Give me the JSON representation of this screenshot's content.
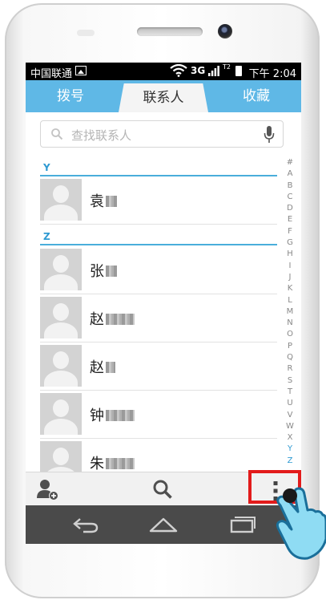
{
  "status_bar": {
    "carrier": "中国联通",
    "network": "3G",
    "sim2": "T2",
    "time": "下午 2:04"
  },
  "tabs": [
    {
      "label": "拨号",
      "active": false
    },
    {
      "label": "联系人",
      "active": true
    },
    {
      "label": "收藏",
      "active": false
    }
  ],
  "search": {
    "placeholder": "查找联系人"
  },
  "sections": [
    {
      "letter": "Y",
      "contacts": [
        {
          "name": "袁"
        }
      ]
    },
    {
      "letter": "Z",
      "contacts": [
        {
          "name": "张"
        },
        {
          "name": "赵"
        },
        {
          "name": "赵"
        },
        {
          "name": "钟"
        },
        {
          "name": "朱"
        }
      ]
    }
  ],
  "alphabet_index": [
    "#",
    "A",
    "B",
    "C",
    "D",
    "E",
    "F",
    "G",
    "H",
    "I",
    "J",
    "K",
    "L",
    "M",
    "N",
    "O",
    "P",
    "Q",
    "R",
    "S",
    "T",
    "U",
    "V",
    "W",
    "X",
    "Y",
    "Z"
  ],
  "colors": {
    "accent": "#5fb8e6",
    "highlight": "#e21b1b",
    "nav_bar": "#4a4a4a"
  },
  "icons": {
    "action_bar": [
      "add-contact-icon",
      "search-icon",
      "overflow-menu-icon"
    ],
    "nav_bar": [
      "back-icon",
      "home-icon",
      "recent-apps-icon"
    ]
  }
}
